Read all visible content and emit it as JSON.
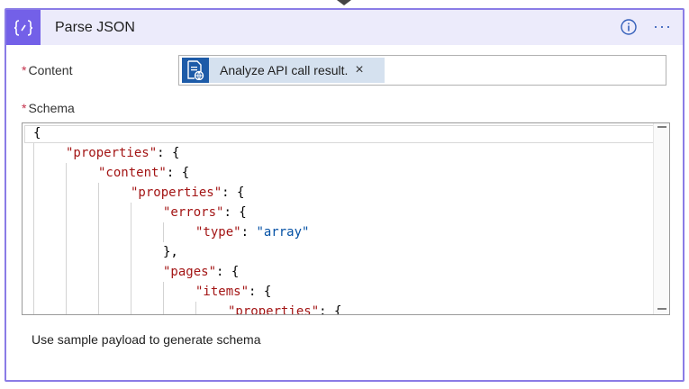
{
  "action": {
    "title": "Parse JSON",
    "icon": "braces-icon",
    "info_icon": "info-icon",
    "more_label": "···",
    "accent": "#7360e8",
    "header_bg": "#ecebfb"
  },
  "fields": {
    "content": {
      "required_mark": "*",
      "label": "Content",
      "token": {
        "label": "Analyze API call result.",
        "remove": "×",
        "icon": "document-api-icon",
        "color": "#1d5ba8"
      }
    },
    "schema": {
      "required_mark": "*",
      "label": "Schema",
      "code": {
        "l1": "{",
        "l2k": "\"properties\"",
        "l2r": ": {",
        "l3k": "\"content\"",
        "l3r": ": {",
        "l4k": "\"properties\"",
        "l4r": ": {",
        "l5k": "\"errors\"",
        "l5r": ": {",
        "l6k": "\"type\"",
        "l6m": ": ",
        "l6v": "\"array\"",
        "l7": "},",
        "l8k": "\"pages\"",
        "l8r": ": {",
        "l9k": "\"items\"",
        "l9r": ": {",
        "l10k": "\"properties\"",
        "l10r": ": {"
      }
    }
  },
  "footer": {
    "sample_link": "Use sample payload to generate schema"
  }
}
